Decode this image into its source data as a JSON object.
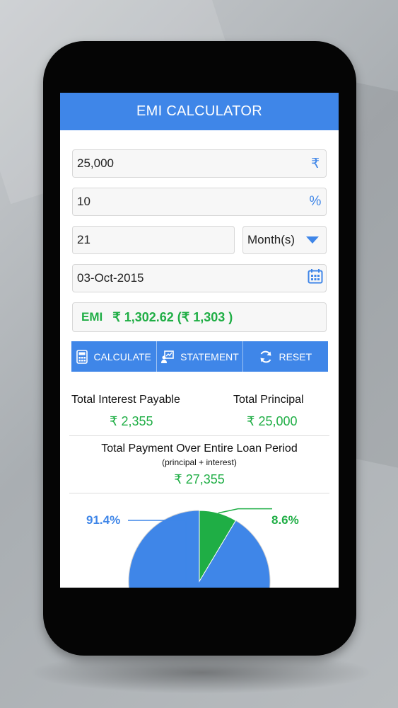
{
  "header": {
    "title": "EMI CALCULATOR"
  },
  "inputs": {
    "amount": {
      "value": "25,000",
      "unit": "₹"
    },
    "rate": {
      "value": "10",
      "unit": "%"
    },
    "tenure": {
      "value": "21"
    },
    "tenure_unit": {
      "selected": "Month(s)"
    },
    "date": {
      "value": "03-Oct-2015"
    }
  },
  "emi": {
    "label": "EMI",
    "value": "₹ 1,302.62 (₹ 1,303 )"
  },
  "buttons": {
    "calculate": "CALCULATE",
    "statement": "STATEMENT",
    "reset": "RESET"
  },
  "summary": {
    "interest_label": "Total Interest Payable",
    "interest_value": "₹ 2,355",
    "principal_label": "Total Principal",
    "principal_value": "₹ 25,000",
    "total_label": "Total Payment Over Entire Loan Period",
    "total_sublabel": "(principal + interest)",
    "total_value": "₹ 27,355"
  },
  "pie": {
    "principal_pct_label": "91.4%",
    "interest_pct_label": "8.6%",
    "principal_pct": 91.4,
    "interest_pct": 8.6,
    "principal_color": "#3f86e8",
    "interest_color": "#1fae45"
  },
  "colors": {
    "accent": "#3f86e8",
    "positive": "#1fae45"
  }
}
